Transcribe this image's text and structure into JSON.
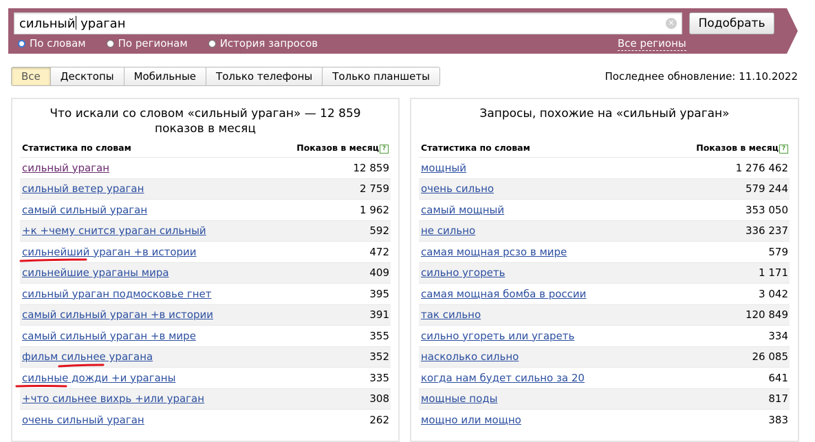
{
  "search": {
    "query": "сильный ураган",
    "submit_label": "Подобрать",
    "modes": [
      "По словам",
      "По регионам",
      "История запросов"
    ],
    "selected_mode": 0,
    "regions_link": "Все регионы"
  },
  "tabs": [
    "Все",
    "Десктопы",
    "Мобильные",
    "Только телефоны",
    "Только планшеты"
  ],
  "active_tab": 0,
  "last_update": "Последнее обновление: 11.10.2022",
  "left_panel": {
    "title_line1": "Что искали со словом «сильный ураган» — 12 859",
    "title_line2": "показов в месяц",
    "col_phrase": "Статистика по словам",
    "col_count": "Показов в месяц",
    "help_icon": "?",
    "rows": [
      {
        "phrase": "сильный ураган",
        "count": "12 859"
      },
      {
        "phrase": "сильный ветер ураган",
        "count": "2 759"
      },
      {
        "phrase": "самый сильный ураган",
        "count": "1 962"
      },
      {
        "phrase": "+к +чему снится ураган сильный",
        "count": "592"
      },
      {
        "phrase": "сильнейший ураган +в истории",
        "count": "472"
      },
      {
        "phrase": "сильнейшие ураганы мира",
        "count": "409"
      },
      {
        "phrase": "сильный ураган подмосковье гнет",
        "count": "395"
      },
      {
        "phrase": "самый сильный ураган +в истории",
        "count": "391"
      },
      {
        "phrase": "самый сильный ураган +в мире",
        "count": "355"
      },
      {
        "phrase": "фильм сильнее урагана",
        "count": "352"
      },
      {
        "phrase": "сильные дожди +и ураганы",
        "count": "335"
      },
      {
        "phrase": "+что сильнее вихрь +или ураган",
        "count": "308"
      },
      {
        "phrase": "очень сильный ураган",
        "count": "262"
      }
    ]
  },
  "right_panel": {
    "title": "Запросы, похожие на «сильный ураган»",
    "col_phrase": "Статистика по словам",
    "col_count": "Показов в месяц",
    "help_icon": "?",
    "rows": [
      {
        "phrase": "мощный",
        "count": "1 276 462"
      },
      {
        "phrase": "очень сильно",
        "count": "579 244"
      },
      {
        "phrase": "самый мощный",
        "count": "353 050"
      },
      {
        "phrase": "не сильно",
        "count": "336 237"
      },
      {
        "phrase": "самая мощная рсзо в мире",
        "count": "579"
      },
      {
        "phrase": "сильно угореть",
        "count": "1 171"
      },
      {
        "phrase": "самая мощная бомба в россии",
        "count": "3 042"
      },
      {
        "phrase": "так сильно",
        "count": "120 849"
      },
      {
        "phrase": "сильно угореть или угареть",
        "count": "334"
      },
      {
        "phrase": "насколько сильно",
        "count": "26 085"
      },
      {
        "phrase": "когда нам будет сильно за 20",
        "count": "641"
      },
      {
        "phrase": "мощные поды",
        "count": "817"
      },
      {
        "phrase": "мощно или мощно",
        "count": "383"
      }
    ]
  },
  "colors": {
    "topbar": "#9e5d73",
    "link": "#2c4fa0",
    "visited_link": "#6a2a6e",
    "annotation": "#e0141e"
  }
}
